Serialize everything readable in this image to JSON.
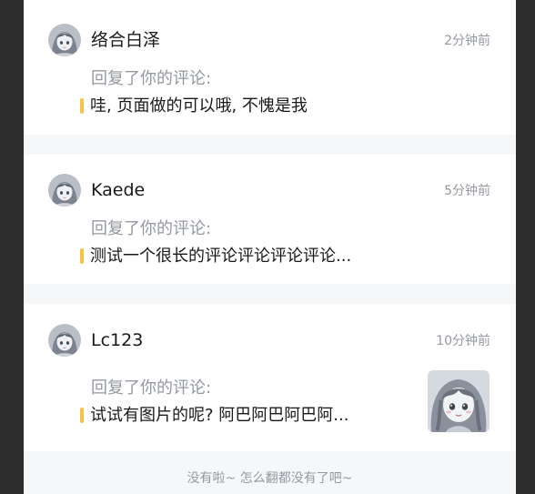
{
  "notifications": [
    {
      "username": "络合白泽",
      "time": "2分钟前",
      "action": "回复了你的评论:",
      "quote": "哇, 页面做的可以哦, 不愧是我",
      "avatar_icon": "anime-girl-avatar-icon"
    },
    {
      "username": "Kaede",
      "time": "5分钟前",
      "action": "回复了你的评论:",
      "quote": "测试一个很长的评论评论评论评论...",
      "avatar_icon": "anime-girl-avatar-icon"
    },
    {
      "username": "Lc123",
      "time": "10分钟前",
      "action": "回复了你的评论:",
      "quote": "试试有图片的呢? 阿巴阿巴阿巴阿...",
      "avatar_icon": "anime-girl-avatar-icon",
      "has_thumbnail": true,
      "thumbnail_icon": "anime-girl-thumbnail-image"
    }
  ],
  "footer": {
    "end_text": "没有啦~ 怎么翻都没有了吧~"
  },
  "colors": {
    "page_background": "#2d2d2d",
    "panel_background": "#f6f7f8",
    "card_background": "#ffffff",
    "quote_bar": "#f6c343",
    "primary_text": "#18191c",
    "secondary_text": "#9499a0"
  }
}
